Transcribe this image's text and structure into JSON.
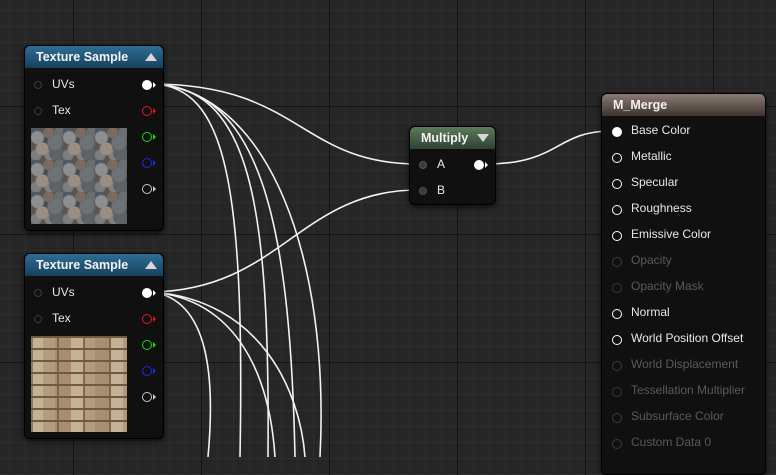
{
  "nodes": {
    "texture_sample_1": {
      "title": "Texture Sample",
      "inputs": [
        "UVs",
        "Tex"
      ],
      "thumbnail": "pebbles-texture"
    },
    "texture_sample_2": {
      "title": "Texture Sample",
      "inputs": [
        "UVs",
        "Tex"
      ],
      "thumbnail": "stone-wall-texture"
    },
    "multiply": {
      "title": "Multiply",
      "inputs": [
        "A",
        "B"
      ]
    },
    "material": {
      "title": "M_Merge",
      "inputs": [
        {
          "label": "Base Color",
          "enabled": true
        },
        {
          "label": "Metallic",
          "enabled": true
        },
        {
          "label": "Specular",
          "enabled": true
        },
        {
          "label": "Roughness",
          "enabled": true
        },
        {
          "label": "Emissive Color",
          "enabled": true
        },
        {
          "label": "Opacity",
          "enabled": false
        },
        {
          "label": "Opacity Mask",
          "enabled": false
        },
        {
          "label": "Normal",
          "enabled": true
        },
        {
          "label": "World Position Offset",
          "enabled": true
        },
        {
          "label": "World Displacement",
          "enabled": false
        },
        {
          "label": "Tessellation Multiplier",
          "enabled": false
        },
        {
          "label": "Subsurface Color",
          "enabled": false
        },
        {
          "label": "Custom Data 0",
          "enabled": false
        }
      ]
    }
  },
  "pin_colors": {
    "rgb": "#ffffff",
    "r": "#e0151b",
    "g": "#16d916",
    "b": "#1b2be8",
    "a": "#c8c8c8"
  },
  "header_colors": {
    "texture_sample": "#2d6e94",
    "multiply": "#5d7a5b",
    "material": "#8a7b72"
  }
}
